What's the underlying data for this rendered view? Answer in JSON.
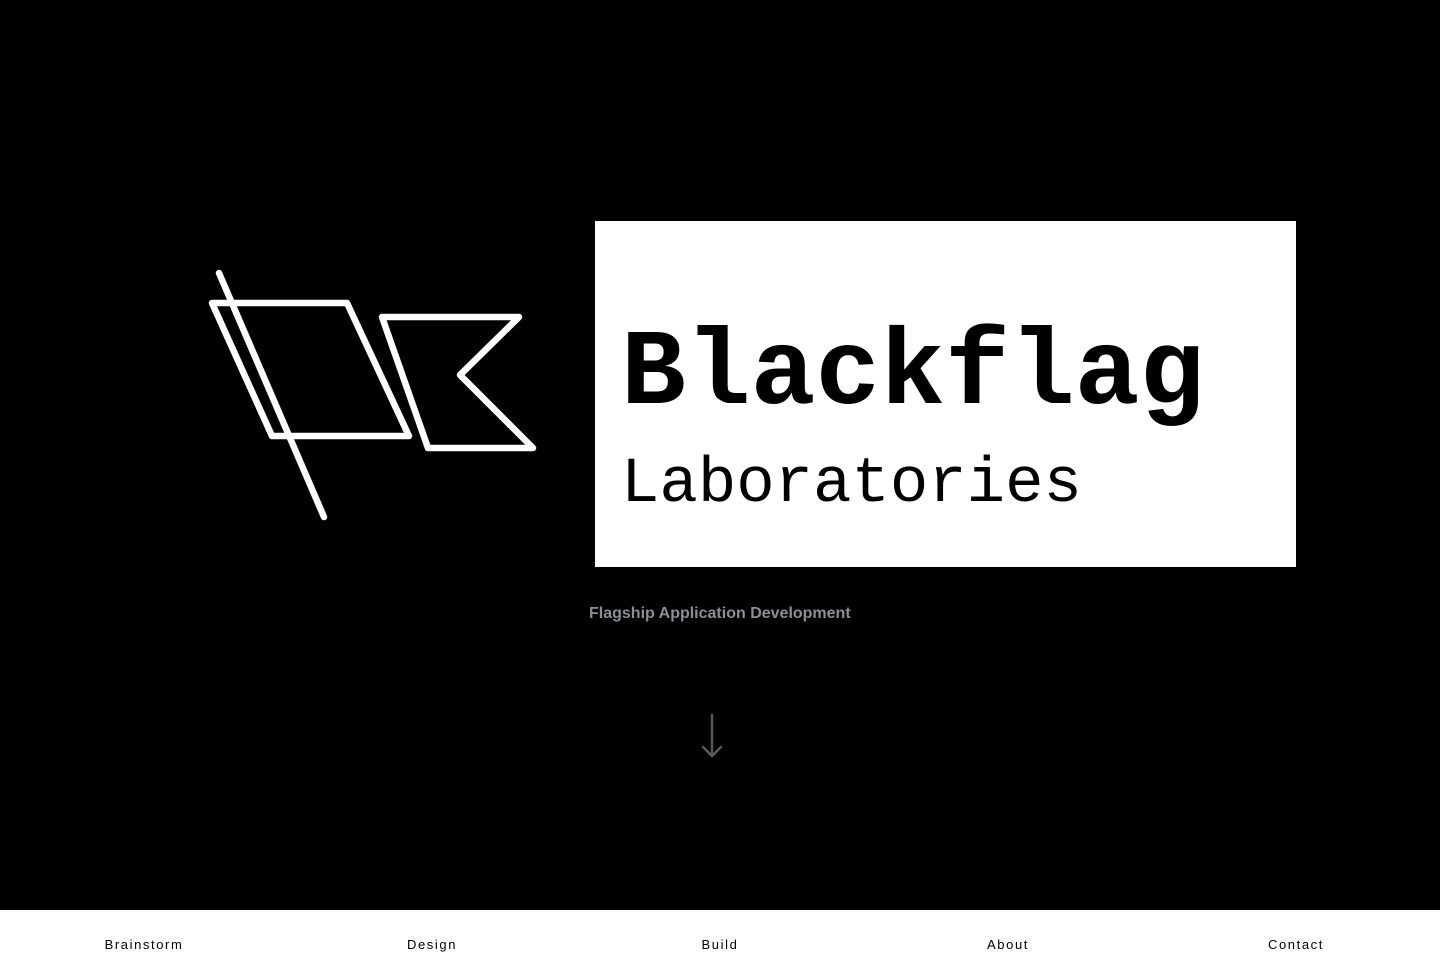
{
  "brand": {
    "name_primary": "Blackflag",
    "name_secondary": "Laboratories",
    "tagline": "Flagship Application Development",
    "logo_icon": "flag-icon"
  },
  "hero": {
    "scroll_icon": "arrow-down-icon"
  },
  "nav": {
    "items": [
      {
        "label": "Brainstorm"
      },
      {
        "label": "Design"
      },
      {
        "label": "Build"
      },
      {
        "label": "About"
      },
      {
        "label": "Contact"
      }
    ]
  },
  "colors": {
    "background": "#000000",
    "wordmark_box": "#ffffff",
    "tagline": "#8a8f96",
    "scroll_arrow": "#5a5a5a",
    "nav_background": "#ffffff",
    "nav_text": "#000000"
  }
}
